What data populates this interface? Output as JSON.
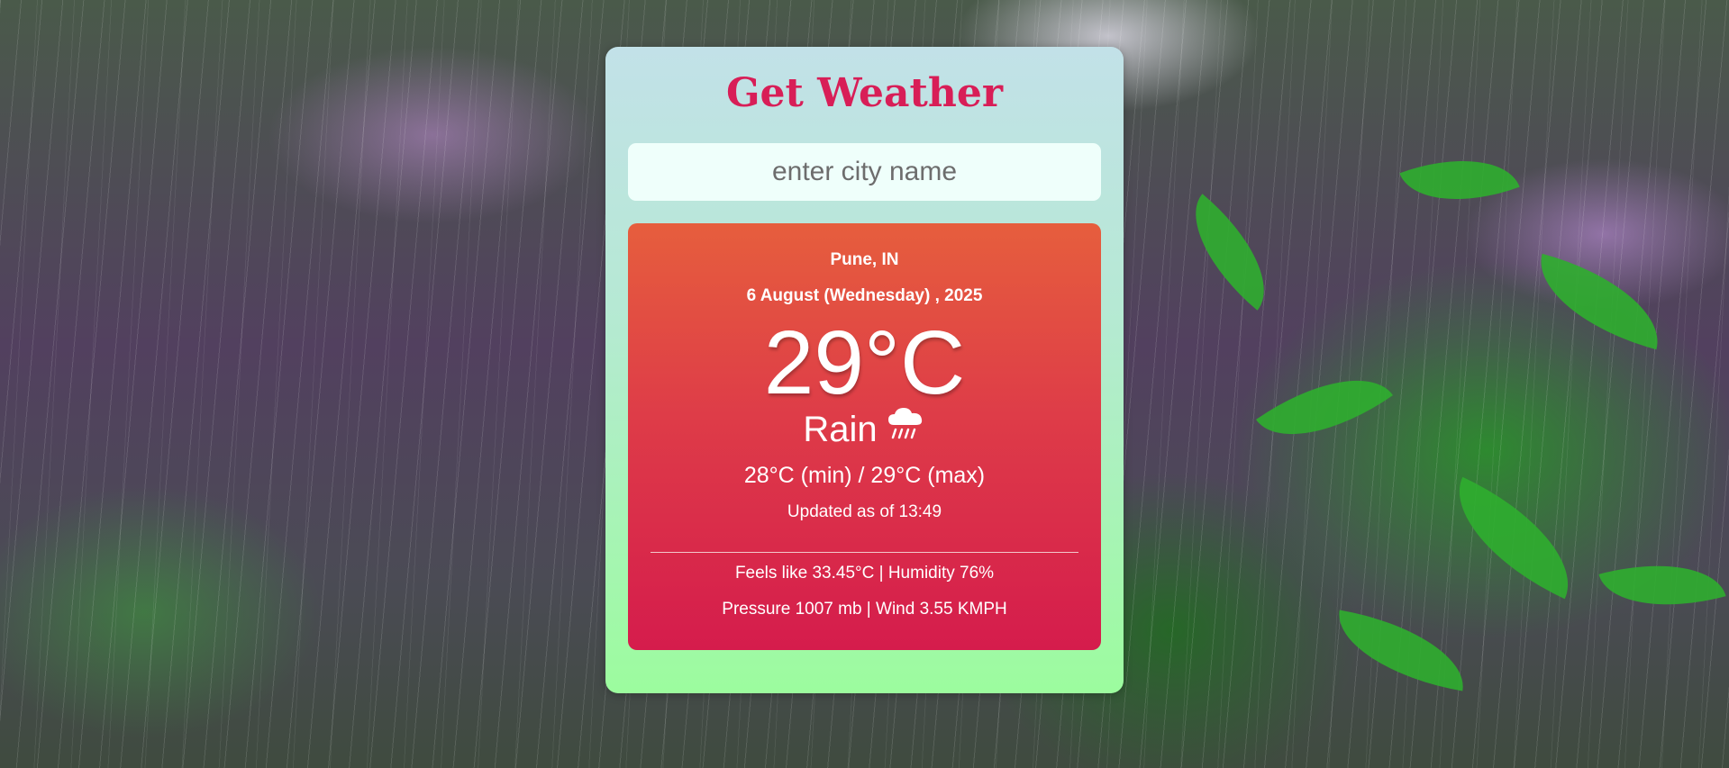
{
  "app": {
    "title": "Get Weather"
  },
  "search": {
    "placeholder": "enter city name",
    "value": ""
  },
  "weather": {
    "location": "Pune, IN",
    "date": "6 August (Wednesday) , 2025",
    "temperature": "29°C",
    "condition": "Rain",
    "condition_icon": "rain-cloud-icon",
    "min_max": "28°C (min) / 29°C (max)",
    "updated": "Updated as of 13:49",
    "feels_humidity": "Feels like 33.45°C | Humidity 76%",
    "pressure_wind": "Pressure 1007 mb | Wind 3.55 KMPH"
  },
  "colors": {
    "title": "#d81e57",
    "card_top": "#c2e1e8",
    "card_bottom": "#9cfc9e",
    "result_top": "#e65e3d",
    "result_bottom": "#d51c4c"
  }
}
